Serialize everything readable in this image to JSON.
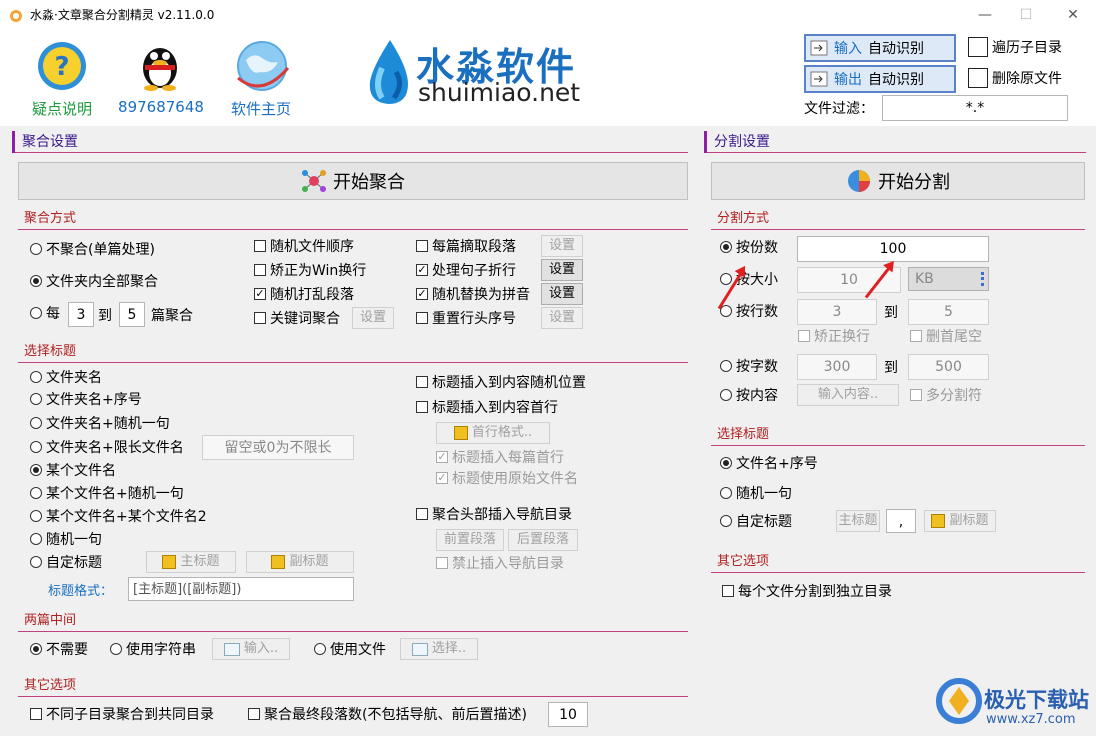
{
  "window": {
    "title": "水淼·文章聚合分割精灵 v2.11.0.0",
    "minimize": "—",
    "maximize": "☐",
    "close": "✕"
  },
  "header": {
    "faq_label": "疑点说明",
    "qq_label": "897687648",
    "homepage_label": "软件主页",
    "logo_cn": "水淼软件",
    "logo_en": "shuimiao.net",
    "input_label": "输入",
    "output_label": "输出",
    "auto_detect": "自动识别",
    "traverse_subdirs": "遍历子目录",
    "delete_source": "删除原文件",
    "file_filter_label": "文件过滤：",
    "file_filter_value": "*.*"
  },
  "merge": {
    "section_title": "聚合设置",
    "start_button": "开始聚合",
    "mode_title": "聚合方式",
    "modes": [
      "不聚合(单篇处理)",
      "文件夹内全部聚合"
    ],
    "every_label": "每",
    "every_from": "3",
    "every_to_label": "到",
    "every_to": "5",
    "every_suffix": "篇聚合",
    "options_col1": [
      "随机文件顺序",
      "矫正为Win换行",
      "随机打乱段落",
      "关键词聚合"
    ],
    "options_col2": [
      "每篇摘取段落",
      "处理句子折行",
      "随机替换为拼音",
      "重置行头序号"
    ],
    "settings_button": "设置",
    "title_section": "选择标题",
    "titles": [
      "文件夹名",
      "文件夹名+序号",
      "文件夹名+随机一句",
      "文件夹名+限长文件名",
      "某个文件名",
      "某个文件名+随机一句",
      "某个文件名+某个文件名2",
      "随机一句",
      "自定标题"
    ],
    "limit_placeholder": "留空或0为不限长",
    "main_title_btn": "主标题",
    "sub_title_btn": "副标题",
    "title_format_label": "标题格式：",
    "title_format_value": "[主标题]([副标题])",
    "insert_random": "标题插入到内容随机位置",
    "insert_first": "标题插入到内容首行",
    "first_line_format": "首行格式..",
    "insert_each_first": "标题插入每篇首行",
    "use_original_name": "标题使用原始文件名",
    "insert_nav": "聚合头部插入导航目录",
    "prefix_para": "前置段落",
    "suffix_para": "后置段落",
    "forbid_nav": "禁止插入导航目录",
    "between_title": "两篇中间",
    "between_options": [
      "不需要",
      "使用字符串",
      "使用文件"
    ],
    "input_btn": "输入..",
    "choose_btn": "选择..",
    "other_title": "其它选项",
    "other_opt1": "不同子目录聚合到共同目录",
    "other_opt2": "聚合最终段落数(不包括导航、前后置描述)",
    "final_para_count": "10"
  },
  "split": {
    "section_title": "分割设置",
    "start_button": "开始分割",
    "mode_title": "分割方式",
    "by_parts": "按份数",
    "parts_value": "100",
    "by_size": "按大小",
    "size_value": "10",
    "size_unit": "KB",
    "by_lines": "按行数",
    "lines_from": "3",
    "to_label": "到",
    "lines_to": "5",
    "fix_newline": "矫正换行",
    "trim_blank": "删首尾空",
    "by_chars": "按字数",
    "chars_from": "300",
    "chars_to": "500",
    "by_content": "按内容",
    "content_btn": "输入内容..",
    "multi_sep": "多分割符",
    "title_section": "选择标题",
    "titles": [
      "文件名+序号",
      "随机一句",
      "自定标题"
    ],
    "main_title_btn": "主标题",
    "sep_value": ",",
    "sub_title_btn": "副标题",
    "other_title": "其它选项",
    "other_opt": "每个文件分割到独立目录"
  },
  "watermark": {
    "cn": "极光下载站",
    "url": "www.xz7.com"
  },
  "colors": {
    "accent_purple": "#8b1fa8",
    "sub_red": "#b02020",
    "label_green": "#1a9b3d",
    "label_blue": "#1a6fc4"
  }
}
